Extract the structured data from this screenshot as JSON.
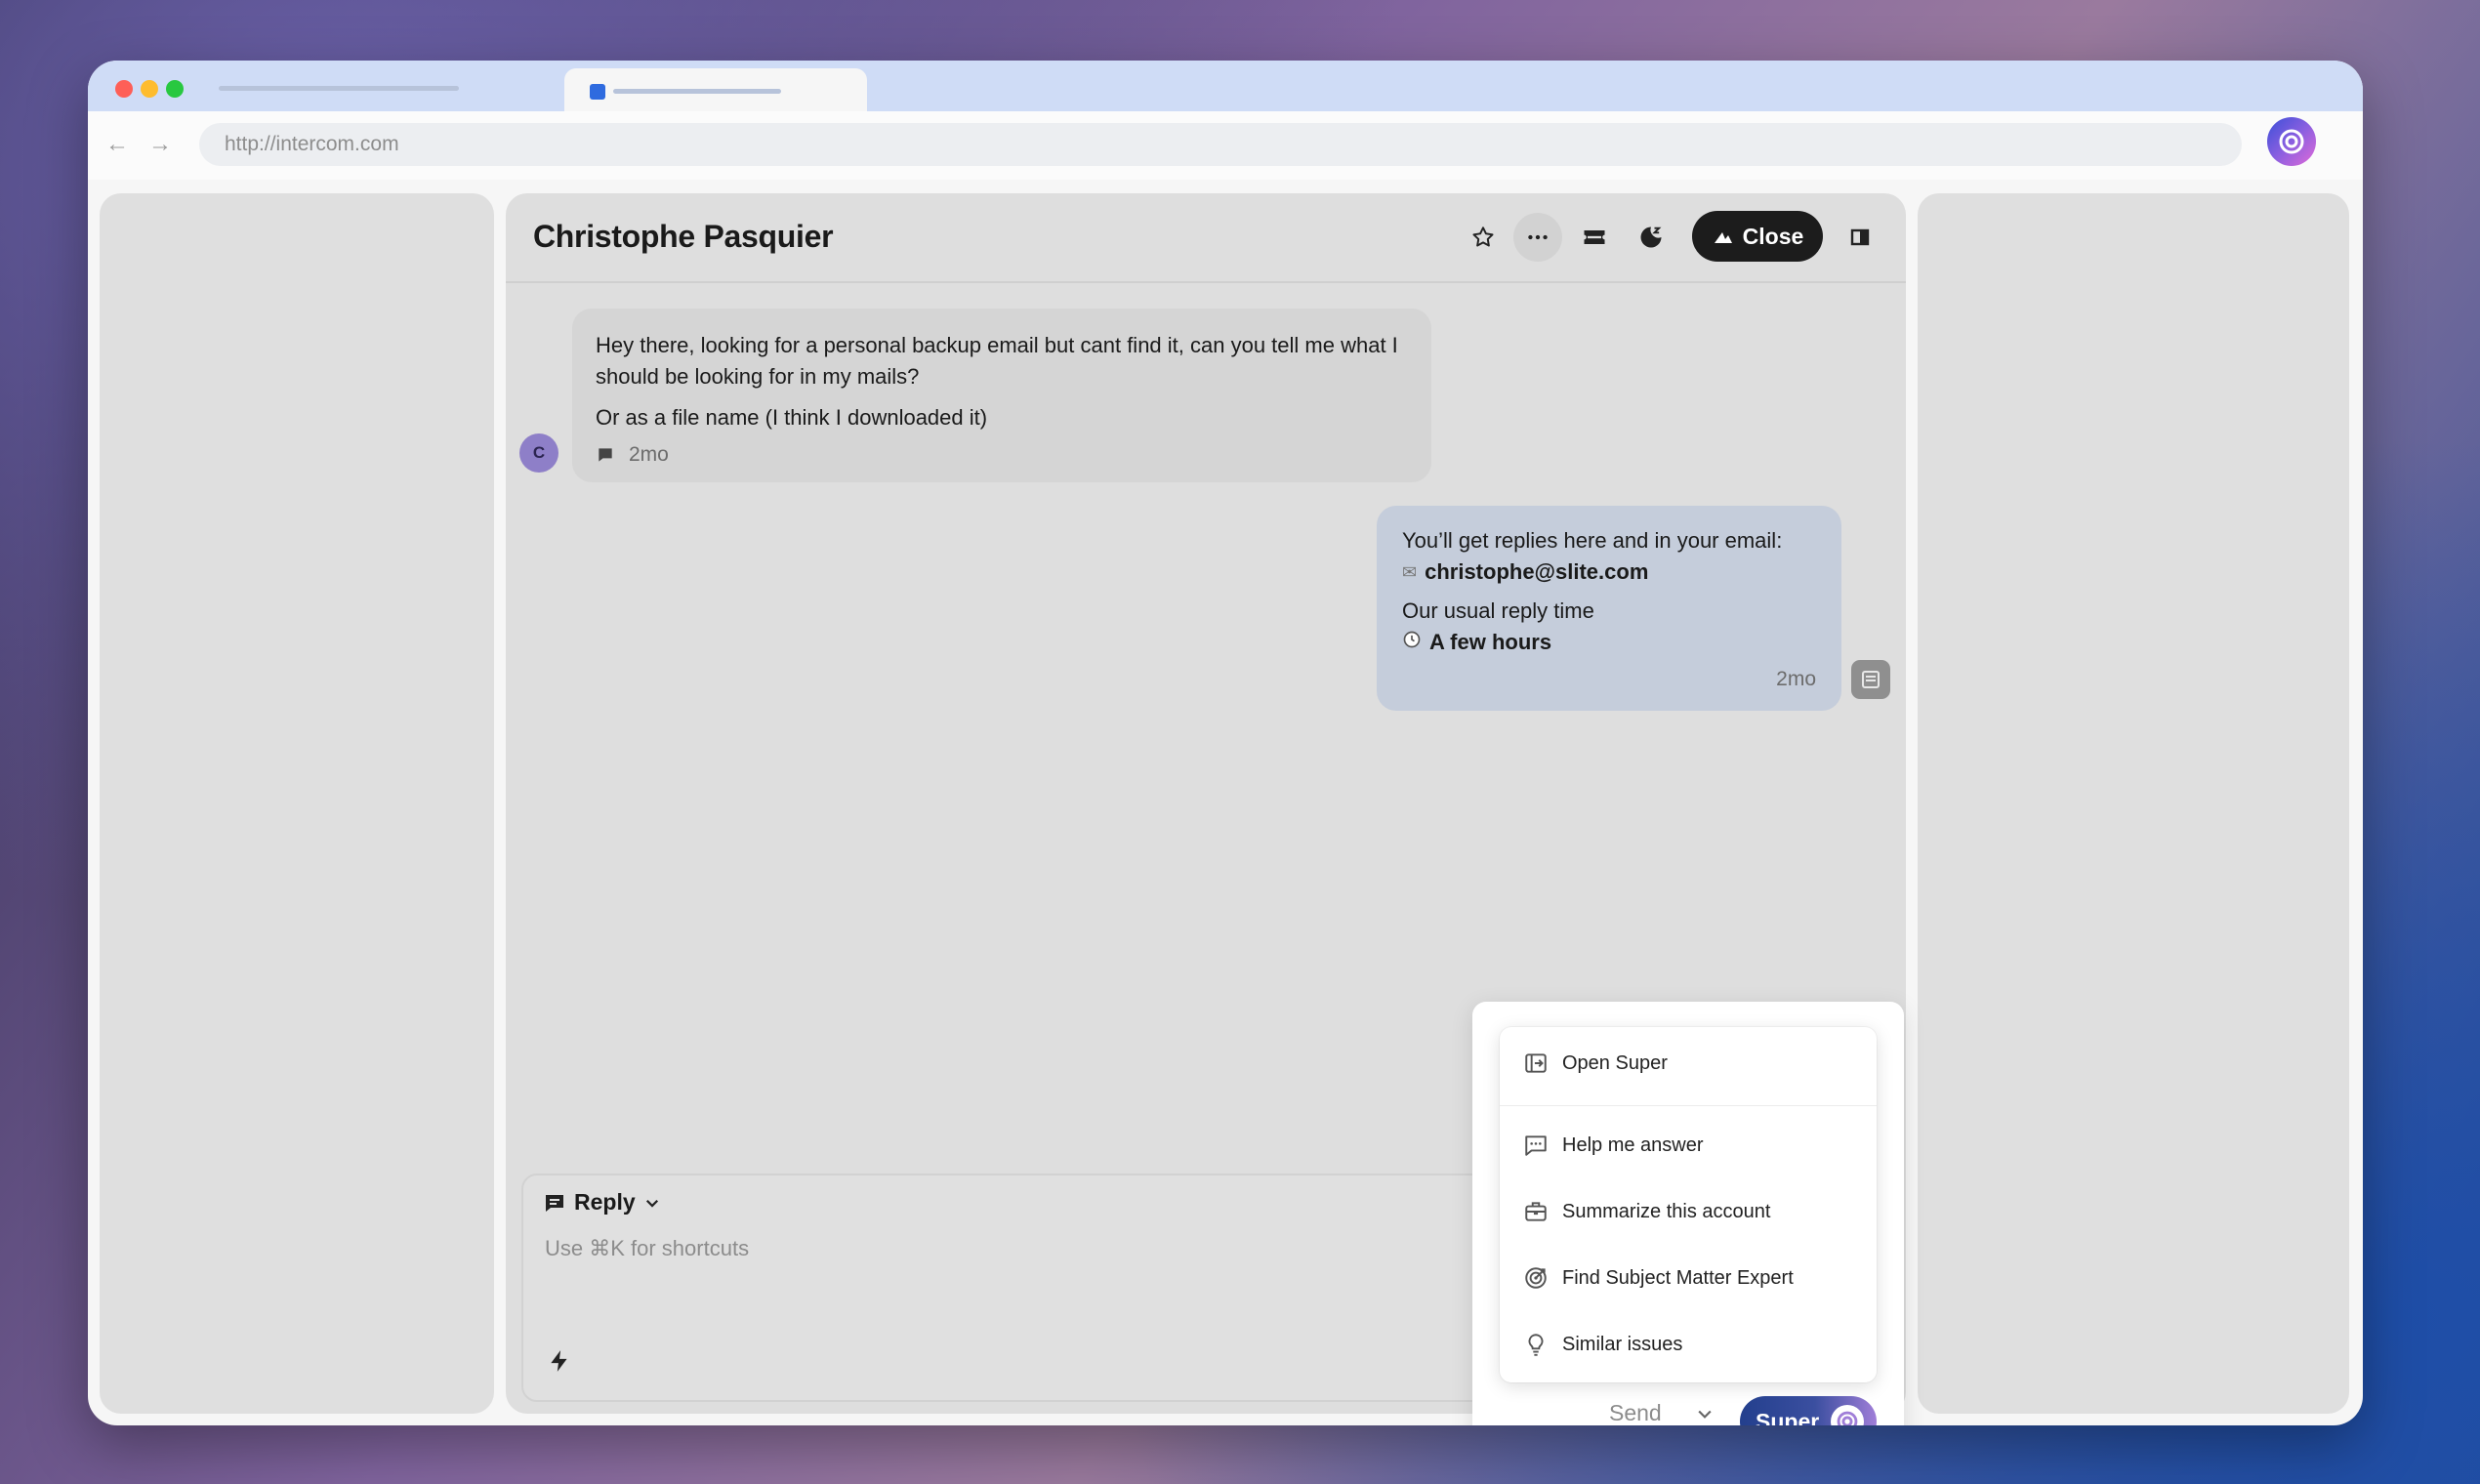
{
  "browser": {
    "url": "http://intercom.com"
  },
  "conversation": {
    "contact_name": "Christophe Pasquier",
    "close_label": "Close",
    "avatar_initial": "C",
    "incoming": {
      "line1": "Hey there, looking for a personal backup email but cant find it, can you tell me what I should be looking for in my mails?",
      "line2": "Or as a file name (I think I downloaded it)",
      "time": "2mo"
    },
    "outgoing": {
      "intro": "You’ll get replies here and in your email:",
      "email": "christophe@slite.com",
      "reply_time_label": "Our usual reply time",
      "reply_time": "A few hours",
      "time": "2mo"
    }
  },
  "composer": {
    "reply_label": "Reply",
    "placeholder": "Use ⌘K for shortcuts",
    "send_label": "Send",
    "super_label": "Super"
  },
  "super_menu": {
    "items": [
      {
        "label": "Open Super",
        "icon": "open-panel-icon"
      },
      {
        "label": "Help me answer",
        "icon": "chat-dots-icon"
      },
      {
        "label": "Summarize this account",
        "icon": "briefcase-icon"
      },
      {
        "label": "Find Subject Matter Expert",
        "icon": "target-icon"
      },
      {
        "label": "Similar issues",
        "icon": "lightbulb-icon"
      }
    ]
  },
  "colors": {
    "accent": "#233f8d",
    "outgoing_bubble": "#c5cddb",
    "close_button": "#1c1c1c"
  }
}
